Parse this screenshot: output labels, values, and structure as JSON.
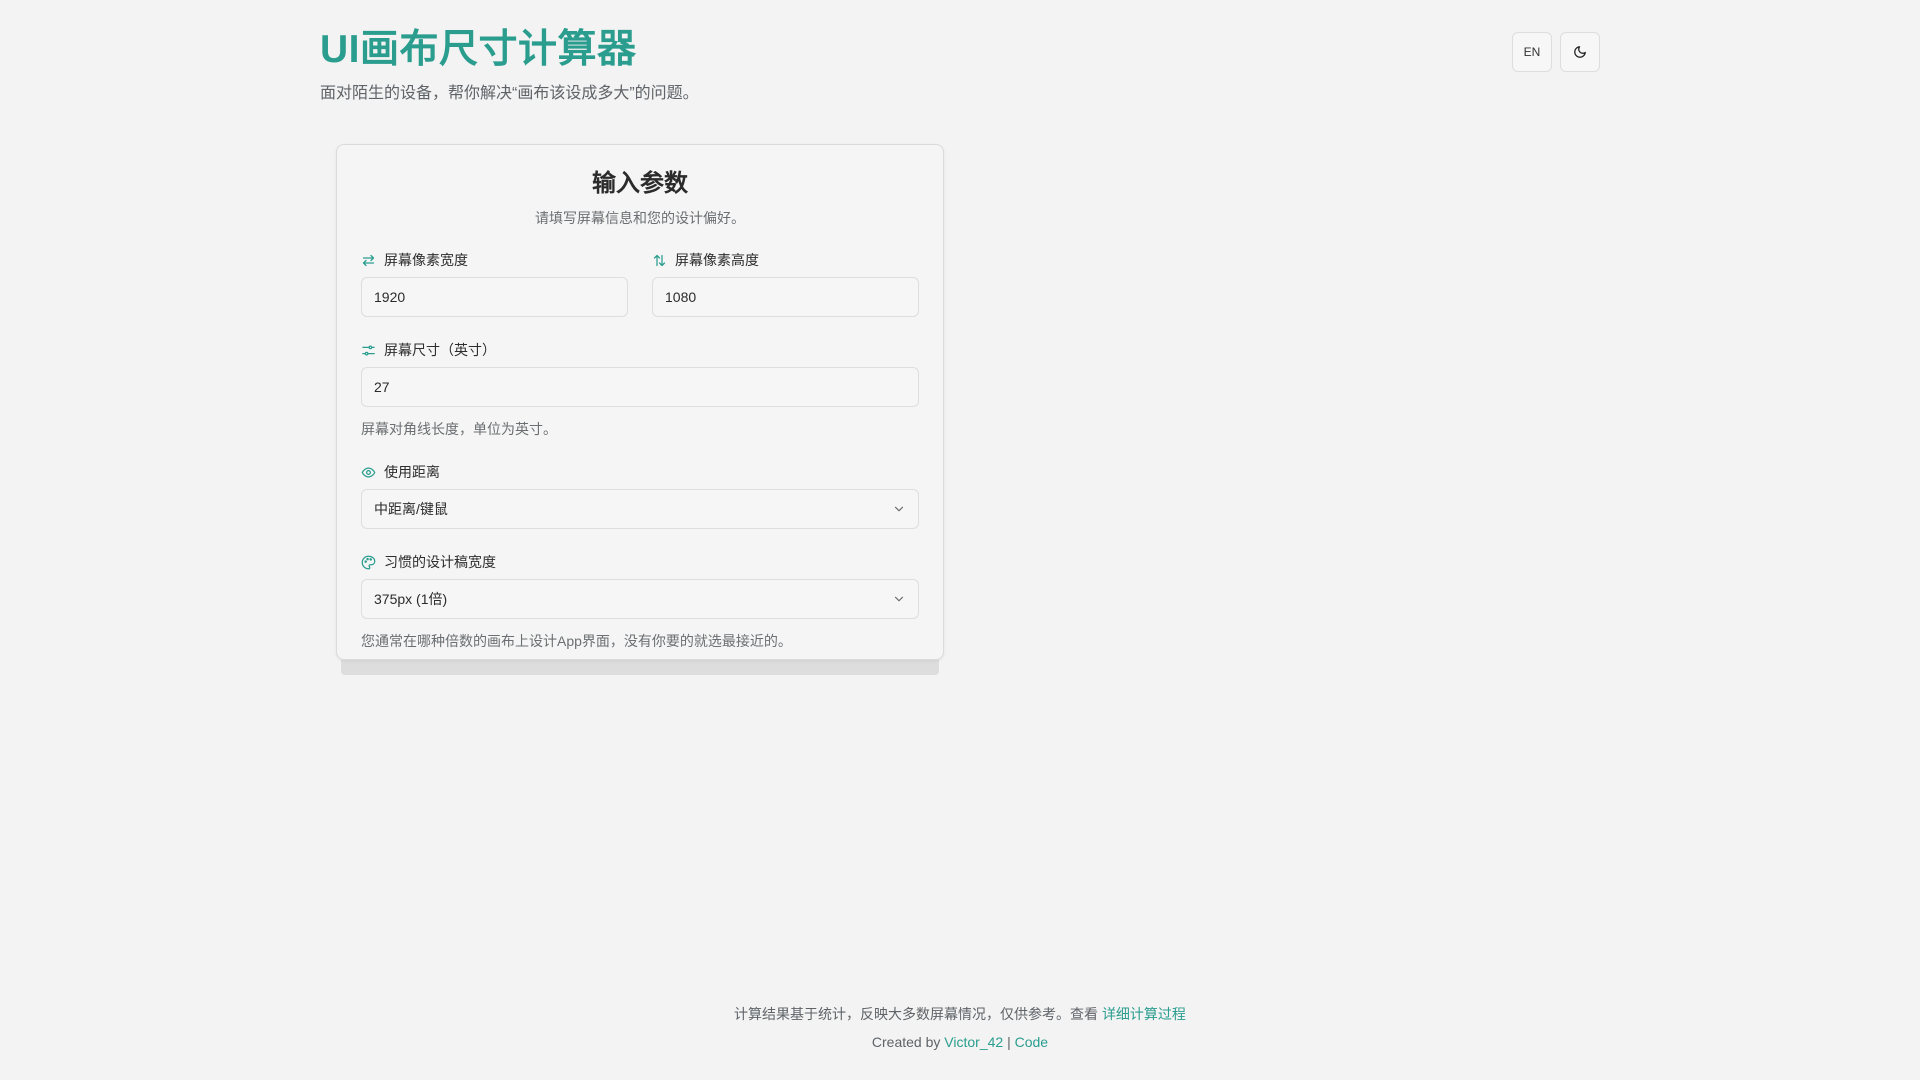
{
  "header": {
    "title": "UI画布尺寸计算器",
    "subtitle": "面对陌生的设备，帮你解决“画布该设成多大”的问题。",
    "lang_button": "EN",
    "theme_icon": "moon-icon"
  },
  "card": {
    "title": "输入参数",
    "description": "请填写屏幕信息和您的设计偏好。",
    "width": {
      "label": "屏幕像素宽度",
      "value": "1920",
      "icon": "arrows-left-right-icon"
    },
    "height": {
      "label": "屏幕像素高度",
      "value": "1080",
      "icon": "arrows-up-down-icon"
    },
    "size": {
      "label": "屏幕尺寸（英寸）",
      "value": "27",
      "hint": "屏幕对角线长度，单位为英寸。",
      "icon": "sliders-icon"
    },
    "distance": {
      "label": "使用距离",
      "selected": "中距离/键鼠",
      "icon": "eye-icon"
    },
    "design_width": {
      "label": "习惯的设计稿宽度",
      "selected": "375px (1倍)",
      "hint": "您通常在哪种倍数的画布上设计App界面，没有你要的就选最接近的。",
      "icon": "palette-icon"
    }
  },
  "footer": {
    "note": "计算结果基于统计，反映大多数屏幕情况，仅供参考。查看",
    "details_link": "详细计算过程",
    "created_by": "Created by",
    "author_link": "Victor_42",
    "separator": "|",
    "code_link": "Code"
  },
  "colors": {
    "accent": "#2a9d8f",
    "background": "#f2f3f2"
  }
}
